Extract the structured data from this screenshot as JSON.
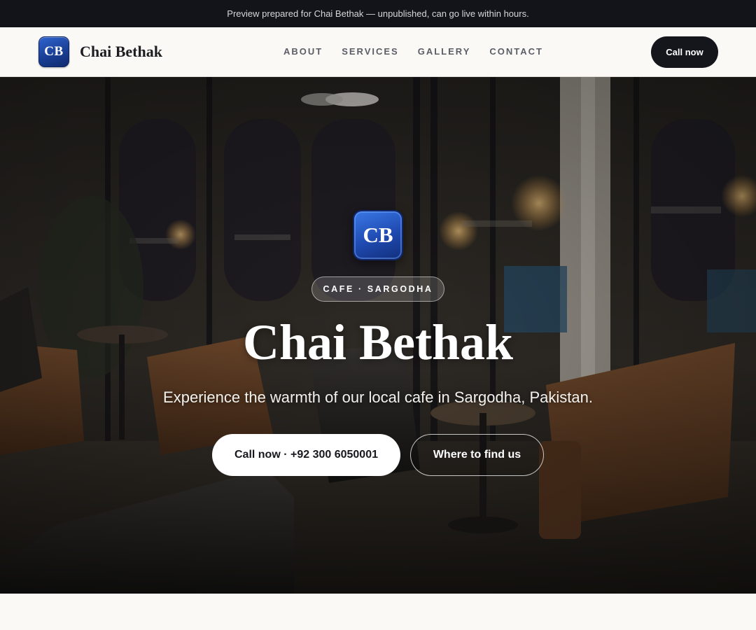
{
  "preview_bar": {
    "text": "Preview prepared for Chai Bethak — unpublished, can go live within hours."
  },
  "nav": {
    "logo_initials": "CB",
    "brand_name": "Chai Bethak",
    "links": [
      "ABOUT",
      "SERVICES",
      "GALLERY",
      "CONTACT"
    ],
    "cta_label": "Call now"
  },
  "hero": {
    "logo_initials": "CB",
    "tag": "CAFE · SARGODHA",
    "title": "Chai Bethak",
    "subtitle": "Experience the warmth of our local cafe in Sargodha, Pakistan.",
    "primary_cta": "Call now · +92 300 6050001",
    "secondary_cta": "Where to find us",
    "background_image": "cafe-interior-photo"
  },
  "colors": {
    "preview_bar_bg": "#12141a",
    "nav_bg": "#faf9f6",
    "brand_blue": "#1f4ab0",
    "dark_button": "#14161c"
  }
}
